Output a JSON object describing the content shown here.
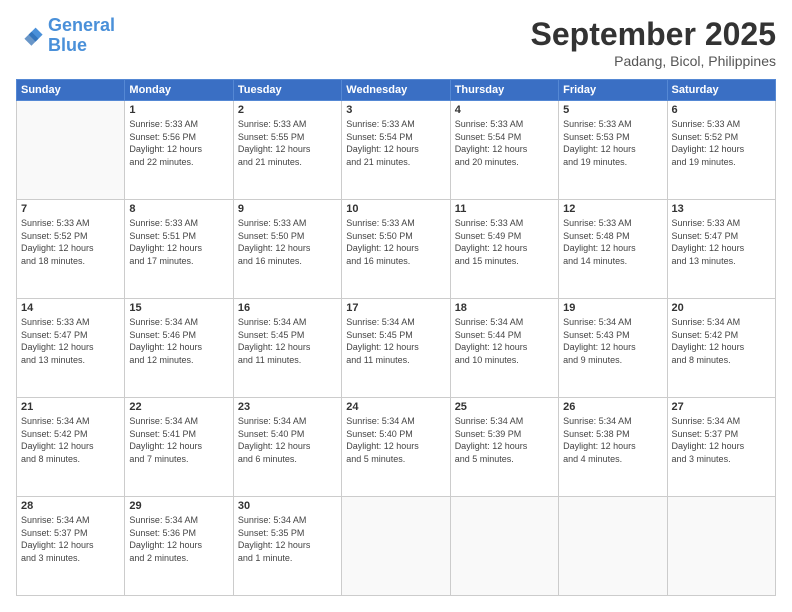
{
  "header": {
    "logo_line1": "General",
    "logo_line2": "Blue",
    "month": "September 2025",
    "location": "Padang, Bicol, Philippines"
  },
  "weekdays": [
    "Sunday",
    "Monday",
    "Tuesday",
    "Wednesday",
    "Thursday",
    "Friday",
    "Saturday"
  ],
  "weeks": [
    [
      {
        "day": "",
        "info": ""
      },
      {
        "day": "1",
        "info": "Sunrise: 5:33 AM\nSunset: 5:56 PM\nDaylight: 12 hours\nand 22 minutes."
      },
      {
        "day": "2",
        "info": "Sunrise: 5:33 AM\nSunset: 5:55 PM\nDaylight: 12 hours\nand 21 minutes."
      },
      {
        "day": "3",
        "info": "Sunrise: 5:33 AM\nSunset: 5:54 PM\nDaylight: 12 hours\nand 21 minutes."
      },
      {
        "day": "4",
        "info": "Sunrise: 5:33 AM\nSunset: 5:54 PM\nDaylight: 12 hours\nand 20 minutes."
      },
      {
        "day": "5",
        "info": "Sunrise: 5:33 AM\nSunset: 5:53 PM\nDaylight: 12 hours\nand 19 minutes."
      },
      {
        "day": "6",
        "info": "Sunrise: 5:33 AM\nSunset: 5:52 PM\nDaylight: 12 hours\nand 19 minutes."
      }
    ],
    [
      {
        "day": "7",
        "info": "Sunrise: 5:33 AM\nSunset: 5:52 PM\nDaylight: 12 hours\nand 18 minutes."
      },
      {
        "day": "8",
        "info": "Sunrise: 5:33 AM\nSunset: 5:51 PM\nDaylight: 12 hours\nand 17 minutes."
      },
      {
        "day": "9",
        "info": "Sunrise: 5:33 AM\nSunset: 5:50 PM\nDaylight: 12 hours\nand 16 minutes."
      },
      {
        "day": "10",
        "info": "Sunrise: 5:33 AM\nSunset: 5:50 PM\nDaylight: 12 hours\nand 16 minutes."
      },
      {
        "day": "11",
        "info": "Sunrise: 5:33 AM\nSunset: 5:49 PM\nDaylight: 12 hours\nand 15 minutes."
      },
      {
        "day": "12",
        "info": "Sunrise: 5:33 AM\nSunset: 5:48 PM\nDaylight: 12 hours\nand 14 minutes."
      },
      {
        "day": "13",
        "info": "Sunrise: 5:33 AM\nSunset: 5:47 PM\nDaylight: 12 hours\nand 13 minutes."
      }
    ],
    [
      {
        "day": "14",
        "info": "Sunrise: 5:33 AM\nSunset: 5:47 PM\nDaylight: 12 hours\nand 13 minutes."
      },
      {
        "day": "15",
        "info": "Sunrise: 5:34 AM\nSunset: 5:46 PM\nDaylight: 12 hours\nand 12 minutes."
      },
      {
        "day": "16",
        "info": "Sunrise: 5:34 AM\nSunset: 5:45 PM\nDaylight: 12 hours\nand 11 minutes."
      },
      {
        "day": "17",
        "info": "Sunrise: 5:34 AM\nSunset: 5:45 PM\nDaylight: 12 hours\nand 11 minutes."
      },
      {
        "day": "18",
        "info": "Sunrise: 5:34 AM\nSunset: 5:44 PM\nDaylight: 12 hours\nand 10 minutes."
      },
      {
        "day": "19",
        "info": "Sunrise: 5:34 AM\nSunset: 5:43 PM\nDaylight: 12 hours\nand 9 minutes."
      },
      {
        "day": "20",
        "info": "Sunrise: 5:34 AM\nSunset: 5:42 PM\nDaylight: 12 hours\nand 8 minutes."
      }
    ],
    [
      {
        "day": "21",
        "info": "Sunrise: 5:34 AM\nSunset: 5:42 PM\nDaylight: 12 hours\nand 8 minutes."
      },
      {
        "day": "22",
        "info": "Sunrise: 5:34 AM\nSunset: 5:41 PM\nDaylight: 12 hours\nand 7 minutes."
      },
      {
        "day": "23",
        "info": "Sunrise: 5:34 AM\nSunset: 5:40 PM\nDaylight: 12 hours\nand 6 minutes."
      },
      {
        "day": "24",
        "info": "Sunrise: 5:34 AM\nSunset: 5:40 PM\nDaylight: 12 hours\nand 5 minutes."
      },
      {
        "day": "25",
        "info": "Sunrise: 5:34 AM\nSunset: 5:39 PM\nDaylight: 12 hours\nand 5 minutes."
      },
      {
        "day": "26",
        "info": "Sunrise: 5:34 AM\nSunset: 5:38 PM\nDaylight: 12 hours\nand 4 minutes."
      },
      {
        "day": "27",
        "info": "Sunrise: 5:34 AM\nSunset: 5:37 PM\nDaylight: 12 hours\nand 3 minutes."
      }
    ],
    [
      {
        "day": "28",
        "info": "Sunrise: 5:34 AM\nSunset: 5:37 PM\nDaylight: 12 hours\nand 3 minutes."
      },
      {
        "day": "29",
        "info": "Sunrise: 5:34 AM\nSunset: 5:36 PM\nDaylight: 12 hours\nand 2 minutes."
      },
      {
        "day": "30",
        "info": "Sunrise: 5:34 AM\nSunset: 5:35 PM\nDaylight: 12 hours\nand 1 minute."
      },
      {
        "day": "",
        "info": ""
      },
      {
        "day": "",
        "info": ""
      },
      {
        "day": "",
        "info": ""
      },
      {
        "day": "",
        "info": ""
      }
    ]
  ]
}
